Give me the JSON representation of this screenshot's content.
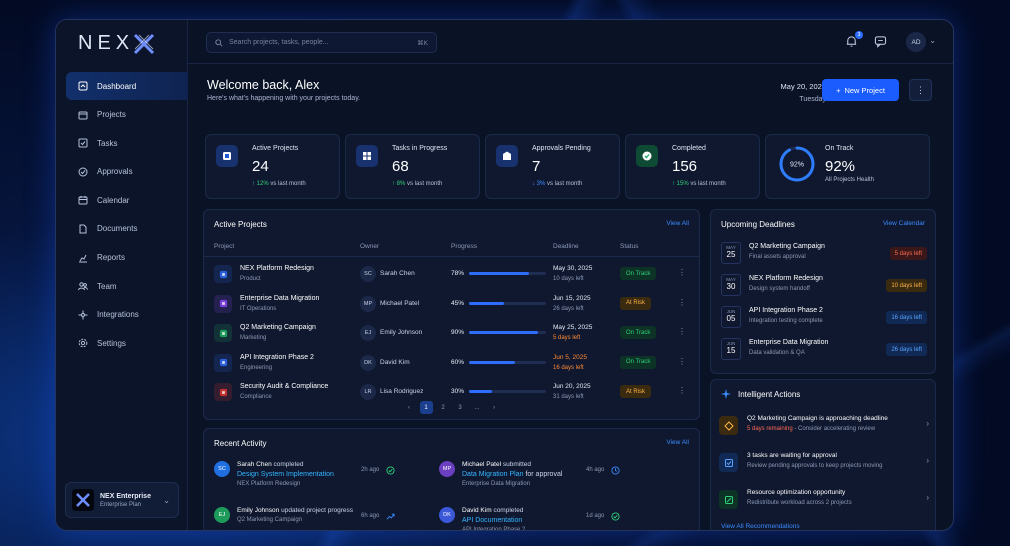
{
  "brand": {
    "name": "NEX"
  },
  "sidebar": {
    "items": [
      {
        "label": "Dashboard",
        "icon": "dashboard-icon",
        "active": true
      },
      {
        "label": "Projects",
        "icon": "projects-icon"
      },
      {
        "label": "Tasks",
        "icon": "tasks-icon"
      },
      {
        "label": "Approvals",
        "icon": "approvals-icon"
      },
      {
        "label": "Calendar",
        "icon": "calendar-icon"
      },
      {
        "label": "Documents",
        "icon": "documents-icon"
      },
      {
        "label": "Reports",
        "icon": "reports-icon"
      },
      {
        "label": "Team",
        "icon": "team-icon"
      },
      {
        "label": "Integrations",
        "icon": "integrations-icon"
      },
      {
        "label": "Settings",
        "icon": "settings-icon"
      }
    ],
    "plan": {
      "name": "NEX Enterprise",
      "sub": "Enterprise Plan"
    }
  },
  "topbar": {
    "search_placeholder": "Search projects, tasks, people...",
    "shortcut": "⌘K",
    "notification_count": "3",
    "avatar": "AD"
  },
  "header": {
    "title": "Welcome back, Alex",
    "subtitle": "Here's what's happening with your projects today.",
    "date": "May 20, 2025",
    "weekday": "Tuesday",
    "new_button": "New Project",
    "more": "⋮"
  },
  "stats": [
    {
      "label": "Active Projects",
      "value": "24",
      "trend_value": "↑ 12%",
      "trend_rest": "vs last month",
      "color": "#1f5bd6"
    },
    {
      "label": "Tasks in Progress",
      "value": "68",
      "trend_value": "↑ 8%",
      "trend_rest": "vs last month",
      "color": "#1f5bd6"
    },
    {
      "label": "Approvals Pending",
      "value": "7",
      "trend_value": "↓ 3%",
      "trend_rest": "vs last month",
      "color": "#1f5bd6"
    },
    {
      "label": "Completed",
      "value": "156",
      "trend_value": "↑ 15%",
      "trend_rest": "vs last month",
      "color": "#19a968"
    }
  ],
  "on_track": {
    "label": "On Track",
    "value": "92%",
    "ring_label": "92%",
    "sub": "All Projects Health",
    "fraction": 0.92
  },
  "projects": {
    "title": "Active Projects",
    "link": "View All",
    "columns": [
      "Project",
      "Owner",
      "Progress",
      "Deadline",
      "Status"
    ],
    "rows": [
      {
        "name": "NEX Platform Redesign",
        "category": "Product",
        "initials": "SC",
        "owner": "Sarah Chen",
        "progress": "78%",
        "fraction": 0.78,
        "deadline": "May 30, 2025",
        "left": "10 days left",
        "warn": false,
        "status": "On Track",
        "status_kind": "ok",
        "icon_color": "#2a5ed8"
      },
      {
        "name": "Enterprise Data Migration",
        "category": "IT Operations",
        "initials": "MP",
        "owner": "Michael Patel",
        "progress": "45%",
        "fraction": 0.45,
        "deadline": "Jun 15, 2025",
        "left": "26 days left",
        "warn": false,
        "status": "At Risk",
        "status_kind": "risk",
        "icon_color": "#7a3fd8"
      },
      {
        "name": "Q2 Marketing Campaign",
        "category": "Marketing",
        "initials": "EJ",
        "owner": "Emily Johnson",
        "progress": "90%",
        "fraction": 0.9,
        "deadline": "May 25, 2025",
        "left": "5 days left",
        "warn": false,
        "left_warn": true,
        "status": "On Track",
        "status_kind": "ok",
        "icon_color": "#1e9b5a"
      },
      {
        "name": "API Integration Phase 2",
        "category": "Engineering",
        "initials": "DK",
        "owner": "David Kim",
        "progress": "60%",
        "fraction": 0.6,
        "deadline": "Jun 5, 2025",
        "left": "16 days left",
        "warn": true,
        "left_warn": true,
        "status": "On Track",
        "status_kind": "ok",
        "icon_color": "#2a5ed8"
      },
      {
        "name": "Security Audit & Compliance",
        "category": "Compliance",
        "initials": "LR",
        "owner": "Lisa Rodriguez",
        "progress": "30%",
        "fraction": 0.3,
        "deadline": "Jun 20, 2025",
        "left": "31 days left",
        "warn": false,
        "status": "At Risk",
        "status_kind": "risk",
        "icon_color": "#c23030"
      }
    ],
    "pager": [
      "‹",
      "1",
      "2",
      "3",
      "...",
      "›"
    ]
  },
  "activity": {
    "title": "Recent Activity",
    "link": "View All",
    "items": [
      {
        "initials": "SC",
        "actor": "Sarah Chen",
        "verb": "completed",
        "target": "Design System Implementation",
        "target_suffix": "",
        "sub": "NEX Platform Redesign",
        "time": "2h ago",
        "avatar_color": "#1f6fe0",
        "icon": "check-circle-icon"
      },
      {
        "initials": "MP",
        "actor": "Michael Patel",
        "verb": "submitted",
        "target": "Data Migration Plan",
        "target_suffix": "for approval",
        "sub": "Enterprise Data Migration",
        "time": "4h ago",
        "avatar_color": "#6a3fc0",
        "icon": "clock-icon"
      },
      {
        "initials": "EJ",
        "actor": "Emily Johnson",
        "verb": "updated project progress",
        "target": "",
        "target_suffix": "",
        "sub": "Q2 Marketing Campaign",
        "time": "6h ago",
        "avatar_color": "#1e9b5a",
        "icon": "trend-icon"
      },
      {
        "initials": "DK",
        "actor": "David Kim",
        "verb": "completed",
        "target": "API Documentation",
        "target_suffix": "",
        "sub": "API Integration Phase 2",
        "time": "1d ago",
        "avatar_color": "#3a58d8",
        "icon": "check-circle-icon"
      }
    ]
  },
  "deadlines": {
    "title": "Upcoming Deadlines",
    "link": "View Calendar",
    "items": [
      {
        "month": "MAY",
        "day": "25",
        "title": "Q2 Marketing Campaign",
        "desc": "Final assets approval",
        "badge": "5 days left",
        "kind": "red"
      },
      {
        "month": "MAY",
        "day": "30",
        "title": "NEX Platform Redesign",
        "desc": "Design system handoff",
        "badge": "10 days left",
        "kind": "amber"
      },
      {
        "month": "JUN",
        "day": "05",
        "title": "API Integration Phase 2",
        "desc": "Integration testing complete",
        "badge": "16 days left",
        "kind": "blue"
      },
      {
        "month": "JUN",
        "day": "15",
        "title": "Enterprise Data Migration",
        "desc": "Data validation & QA",
        "badge": "26 days left",
        "kind": "blue"
      }
    ]
  },
  "intelligent": {
    "title": "Intelligent Actions",
    "items": [
      {
        "title": "Q2 Marketing Campaign is approaching deadline",
        "desc_red": "5 days remaining",
        "desc": " - Consider accelerating review",
        "color": "#3a2a10",
        "ico": "#ffb547"
      },
      {
        "title": "3 tasks are waiting for approval",
        "desc_red": "",
        "desc": "Review pending approvals to keep projects moving",
        "color": "#102a55",
        "ico": "#5aa2ff"
      },
      {
        "title": "Resource optimization opportunity",
        "desc_red": "",
        "desc": "Redistribute workload across 2 projects",
        "color": "#0c3325",
        "ico": "#2fd27a"
      }
    ],
    "footer": "View All Recommendations"
  }
}
